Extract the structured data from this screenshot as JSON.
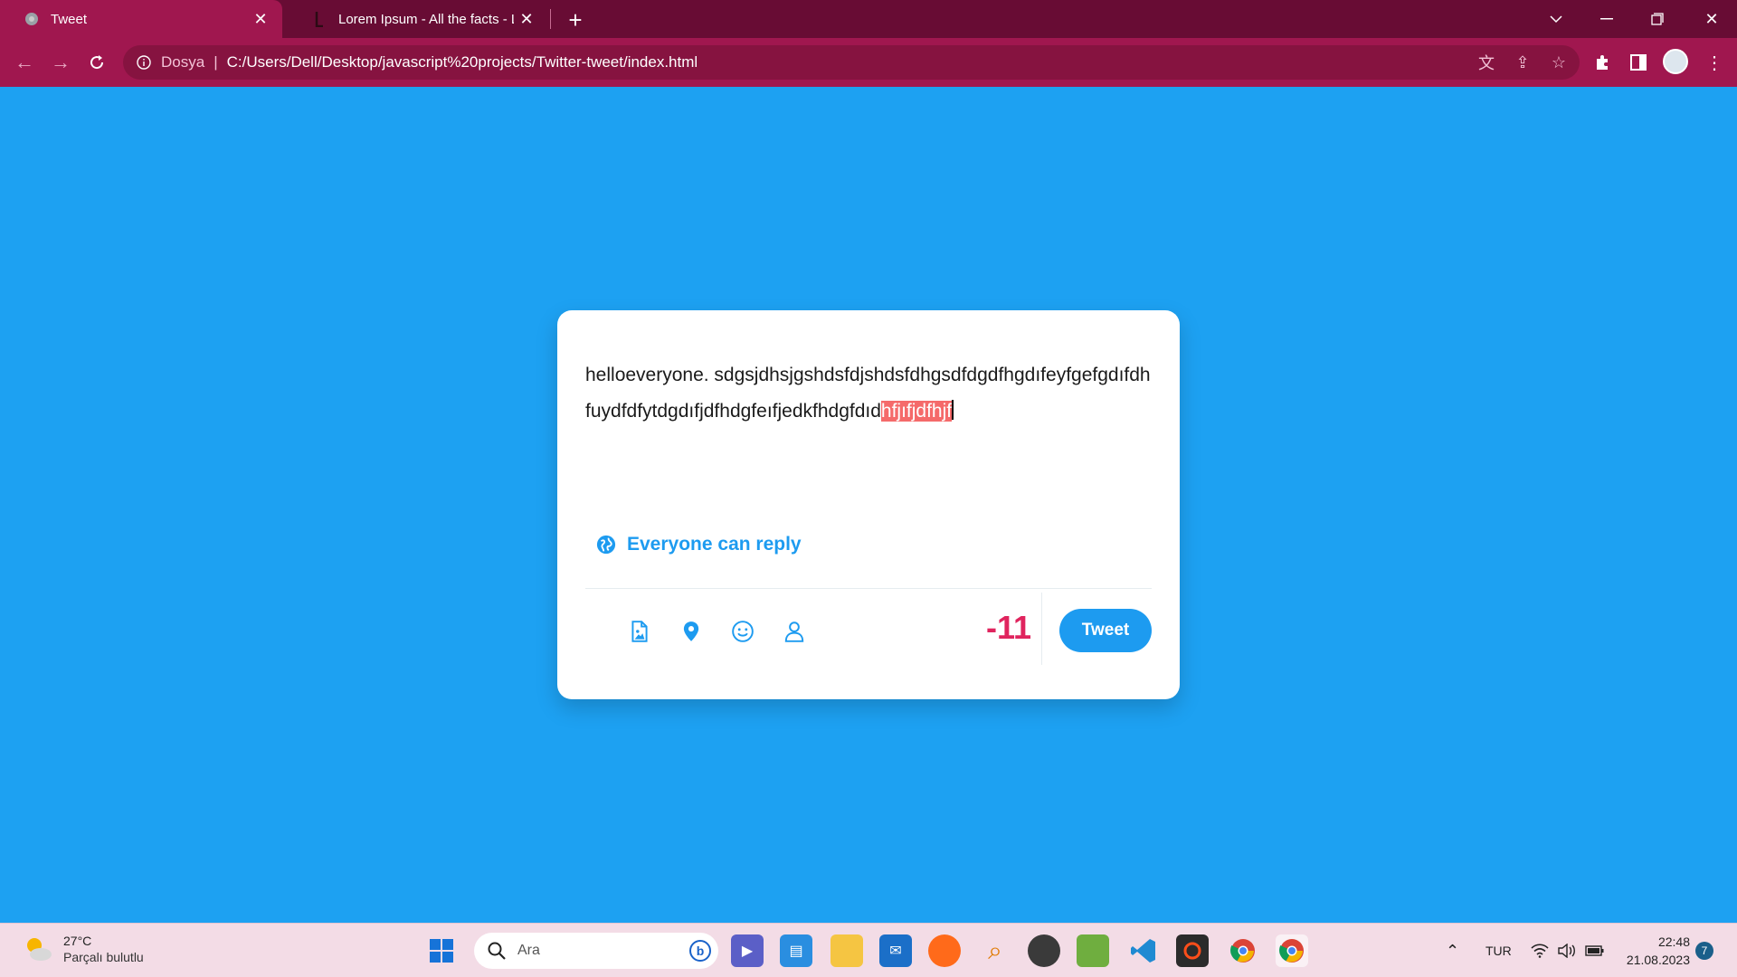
{
  "browser": {
    "tabs": [
      {
        "title": "Tweet",
        "active": true
      },
      {
        "title": "Lorem Ipsum - All the facts - Lips",
        "active": false
      }
    ],
    "address": {
      "scheme_label": "Dosya",
      "url": "C:/Users/Dell/Desktop/javascript%20projects/Twitter-tweet/index.html"
    }
  },
  "tweet": {
    "text_normal": "helloeveryone. sdgsjdhsjgshdsfdjshdsfdhgsdfdgdfhgdıfeyfgefgdıfdhfuydfdfytdgdıfjdfhdgfeıfjedkfhdgfdıd",
    "text_overflow": "hfjıfjdfhjf",
    "reply_label": "Everyone can reply",
    "counter": "-11",
    "tweet_button": "Tweet",
    "counter_color": "#e0245e",
    "accent": "#1d9bf0"
  },
  "taskbar": {
    "weather": {
      "temp": "27°C",
      "desc": "Parçalı bulutlu"
    },
    "search_placeholder": "Ara",
    "language": "TUR",
    "time": "22:48",
    "date": "21.08.2023",
    "notifications": "7",
    "apps": [
      "start-icon",
      "teams-icon",
      "store-icon",
      "file-explorer-icon",
      "mail-icon",
      "firefox-icon",
      "search-app-icon",
      "obs-icon",
      "paint-icon",
      "vscode-icon",
      "record-icon",
      "chrome-icon",
      "chrome-profile-icon"
    ]
  }
}
